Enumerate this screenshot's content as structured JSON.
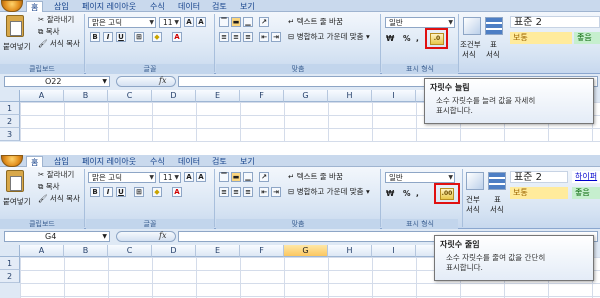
{
  "screens": [
    {
      "tabs": [
        "홈",
        "삽입",
        "페이지 레이아웃",
        "수식",
        "데이터",
        "검토",
        "보기"
      ],
      "clipboard": {
        "paste_label": "붙여넣기",
        "cut_label": "잘라내기",
        "copy_label": "복사",
        "format_painter_label": "서식 복사",
        "group_label": "클립보드"
      },
      "font": {
        "font_name": "맑은 고딕",
        "font_size": "11",
        "bold": "B",
        "italic": "I",
        "underline": "U",
        "group_label": "글꼴"
      },
      "alignment": {
        "wrap_text_label": "텍스트 줄 바꿈",
        "merge_label": "병합하고 가운데 맞춤",
        "group_label": "맞춤"
      },
      "number": {
        "format_value": "일반",
        "currency_label": "₩",
        "percent_label": "%",
        "comma_label": ",",
        "group_label": "표시 형식"
      },
      "styles": {
        "conditional_label": "조건부",
        "conditional_label2": "서식",
        "table_label": "표",
        "table_label2": "서식",
        "normal_label": "표준 2",
        "neutral_label": "보통",
        "good_label": "좋음"
      },
      "name_box": "O22",
      "fx_label": "fx",
      "columns": [
        "A",
        "B",
        "C",
        "D",
        "E",
        "F",
        "G",
        "H",
        "I",
        "J",
        "K",
        "L",
        "M"
      ],
      "rows": [
        "1",
        "2",
        "3"
      ],
      "tooltip": {
        "title": "자릿수 늘림",
        "line1": "소수 자릿수를 늘려 값을 자세히",
        "line2": "표시합니다."
      }
    },
    {
      "tabs": [
        "홈",
        "삽입",
        "페이지 레이아웃",
        "수식",
        "데이터",
        "검토",
        "보기"
      ],
      "clipboard": {
        "paste_label": "붙여넣기",
        "cut_label": "잘라내기",
        "copy_label": "복사",
        "format_painter_label": "서식 복사",
        "group_label": "클립보드"
      },
      "font": {
        "font_name": "맑은 고딕",
        "font_size": "11",
        "bold": "B",
        "italic": "I",
        "underline": "U",
        "group_label": "글꼴"
      },
      "alignment": {
        "wrap_text_label": "텍스트 줄 바꿈",
        "merge_label": "병합하고 가운데 맞춤",
        "group_label": "맞춤"
      },
      "number": {
        "format_value": "일반",
        "currency_label": "₩",
        "percent_label": "%",
        "comma_label": ",",
        "group_label": "표시 형식"
      },
      "styles": {
        "conditional_label": "건부",
        "conditional_label2": "서식",
        "table_label": "표",
        "table_label2": "서식",
        "normal_label": "표준 2",
        "neutral_label": "보통",
        "good_label": "좋음",
        "bad_label": "하이퍼"
      },
      "name_box": "G4",
      "fx_label": "fx",
      "columns": [
        "A",
        "B",
        "C",
        "D",
        "E",
        "F",
        "G",
        "H",
        "I",
        "J"
      ],
      "rows": [
        "1",
        "2"
      ],
      "tooltip": {
        "title": "자릿수 줄임",
        "line1": "소수 자릿수를 줄여 값을 간단히",
        "line2": "표시합니다."
      }
    }
  ],
  "colors": {
    "highlight": "#e01010",
    "ribbon_bg": "#dfe9f5",
    "selected_column": "#fbc660"
  },
  "icons": [
    "office-button-icon",
    "paste-icon",
    "cut-icon",
    "copy-icon",
    "format-painter-icon",
    "bold-icon",
    "italic-icon",
    "underline-icon",
    "border-icon",
    "fill-color-icon",
    "font-color-icon",
    "align-icon",
    "wrap-text-icon",
    "merge-icon",
    "increase-decimal-icon",
    "decrease-decimal-icon",
    "conditional-format-icon",
    "table-format-icon",
    "fx-icon"
  ]
}
